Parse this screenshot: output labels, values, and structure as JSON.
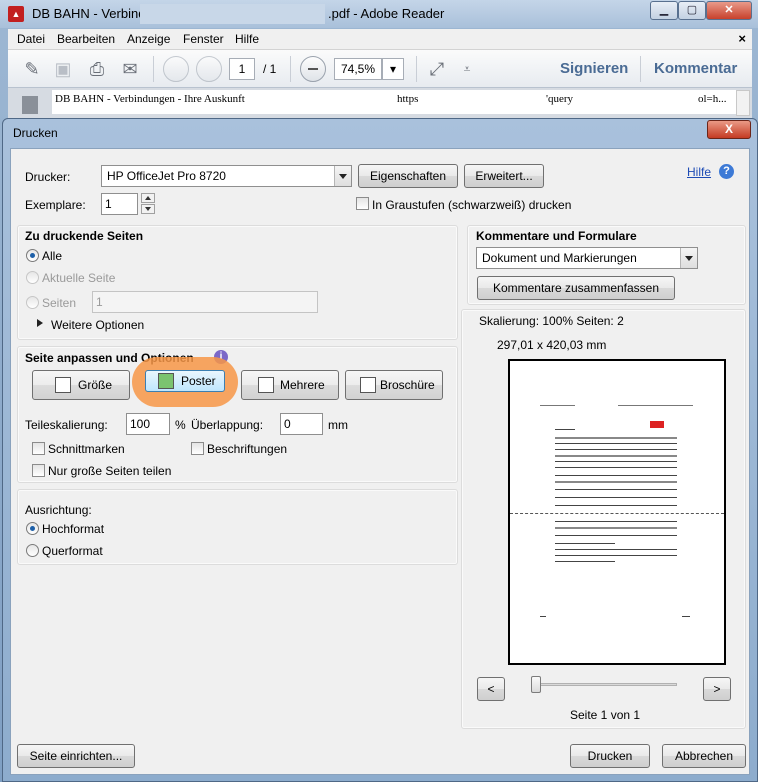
{
  "app": {
    "title_prefix": "DB BAHN - Verbind",
    "title_suffix": ".pdf - Adobe Reader",
    "icon": "pdf-icon",
    "menu": [
      "Datei",
      "Bearbeiten",
      "Anzeige",
      "Fenster",
      "Hilfe"
    ],
    "menu_close": "×",
    "toolbar": {
      "page_current": "1",
      "page_total": "/ 1",
      "zoom": "74,5%",
      "sign_label": "Signieren",
      "comment_label": "Kommentar"
    },
    "doc_header": {
      "left": "DB BAHN - Verbindungen - Ihre Auskunft",
      "middle": "https",
      "right1": "'query",
      "right2": "ol=h..."
    }
  },
  "dialog": {
    "title": "Drucken",
    "close": "X",
    "printer_label": "Drucker:",
    "printer_value": "HP OfficeJet Pro 8720",
    "properties_button": "Eigenschaften",
    "advanced_button": "Erweitert...",
    "help_link": "Hilfe",
    "copies_label": "Exemplare:",
    "copies_value": "1",
    "grayscale_label": "In Graustufen (schwarzweiß) drucken",
    "pages_section": {
      "title": "Zu druckende Seiten",
      "all": "Alle",
      "current": "Aktuelle Seite",
      "pages": "Seiten",
      "pages_value": "1",
      "more_options": "Weitere Optionen",
      "selected": "all"
    },
    "fit_section": {
      "title": "Seite anpassen und Optionen",
      "modes": [
        "Größe",
        "Poster",
        "Mehrere",
        "Broschüre"
      ],
      "selected_mode": "Poster",
      "tile_scale_label": "Teileskalierung:",
      "tile_scale_value": "100",
      "tile_scale_unit": "%",
      "overlap_label": "Überlappung:",
      "overlap_value": "0",
      "overlap_unit": "mm",
      "cut_marks": "Schnittmarken",
      "labels": "Beschriftungen",
      "large_pages_only": "Nur große Seiten teilen"
    },
    "orientation_section": {
      "title": "Ausrichtung:",
      "portrait": "Hochformat",
      "landscape": "Querformat",
      "selected": "portrait"
    },
    "comments_section": {
      "title": "Kommentare und Formulare",
      "select_value": "Dokument und Markierungen",
      "summarize_button": "Kommentare zusammenfassen"
    },
    "preview": {
      "scaling": "Skalierung: 100% Seiten: 2",
      "size": "297,01 x 420,03 mm",
      "prev": "<",
      "next": ">",
      "page_info": "Seite 1 von 1"
    },
    "page_setup_button": "Seite einrichten...",
    "print_button": "Drucken",
    "cancel_button": "Abbrechen"
  },
  "colors": {
    "highlight": "#f79646",
    "link": "#1d4bb5",
    "accent": "#4a6b94"
  }
}
